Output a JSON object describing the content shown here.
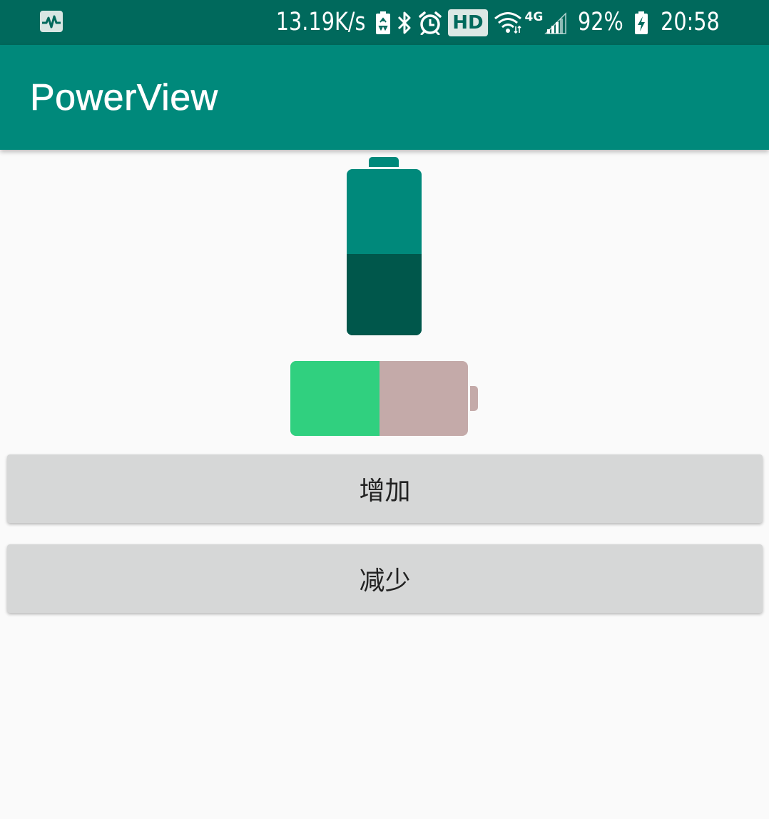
{
  "status_bar": {
    "notification_icon": "activity-monitor-icon",
    "net_speed": "13.19K/s",
    "icons": [
      "battery-saver-icon",
      "bluetooth-icon",
      "alarm-clock-icon"
    ],
    "hd_label": "HD",
    "wifi_icon": "wifi-icon",
    "network_type": "4G",
    "signal_icon": "cell-signal-icon",
    "battery_percent": "92%",
    "charging_icon": "battery-charging-icon",
    "time": "20:58",
    "colors": {
      "background": "#00695c",
      "text": "#ffffff"
    }
  },
  "app_bar": {
    "title": "PowerView",
    "color": "#00897b"
  },
  "power_views": {
    "vertical": {
      "level": 0.49,
      "body_color": "#00897b",
      "fill_color": "#00574b"
    },
    "horizontal": {
      "level": 0.5,
      "body_color": "#c4aaa9",
      "fill_color": "#30d07f"
    }
  },
  "buttons": {
    "increase_label": "增加",
    "decrease_label": "减少",
    "color": "#d6d7d7"
  }
}
